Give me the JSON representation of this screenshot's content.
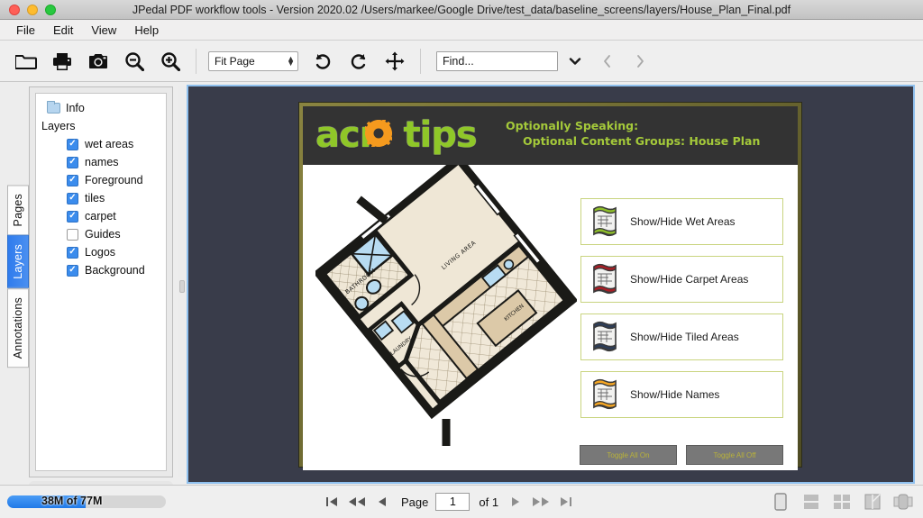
{
  "window": {
    "title": "JPedal PDF workflow tools - Version 2020.02 /Users/markee/Google Drive/test_data/baseline_screens/layers/House_Plan_Final.pdf",
    "controls": [
      "close",
      "minimize",
      "maximize"
    ]
  },
  "menubar": {
    "items": [
      {
        "label": "File"
      },
      {
        "label": "Edit"
      },
      {
        "label": "View"
      },
      {
        "label": "Help"
      }
    ]
  },
  "toolbar": {
    "buttons": [
      {
        "name": "open-file-icon",
        "title": "Open"
      },
      {
        "name": "print-icon",
        "title": "Print"
      },
      {
        "name": "snapshot-icon",
        "title": "Snapshot"
      },
      {
        "name": "zoom-out-icon",
        "title": "Zoom Out"
      },
      {
        "name": "zoom-in-icon",
        "title": "Zoom In"
      }
    ],
    "zoom_value": "Fit Page",
    "rotate_left": "Rotate Left",
    "rotate_right": "Rotate Right",
    "pan": "Pan",
    "find_placeholder": "Find...",
    "find_value": "",
    "find_dropdown": "⌄",
    "find_prev": "‹",
    "find_next": "›"
  },
  "sidebar": {
    "tabs": [
      {
        "label": "Pages",
        "active": false
      },
      {
        "label": "Layers",
        "active": true
      },
      {
        "label": "Annotations",
        "active": false
      }
    ],
    "tree": {
      "info_label": "Info",
      "group_label": "Layers",
      "layers": [
        {
          "label": "wet areas",
          "checked": true
        },
        {
          "label": "names",
          "checked": true
        },
        {
          "label": "Foreground",
          "checked": true
        },
        {
          "label": "tiles",
          "checked": true
        },
        {
          "label": "carpet",
          "checked": true
        },
        {
          "label": "Guides",
          "checked": false
        },
        {
          "label": "Logos",
          "checked": true
        },
        {
          "label": "Background",
          "checked": true
        }
      ]
    }
  },
  "document": {
    "logo_text_1": "acr",
    "logo_text_2": "tips",
    "headline_line1": "Optionally Speaking:",
    "headline_line2": "Optional Content Groups:  House Plan",
    "floorplan": {
      "labels": [
        {
          "text": "BATHROOM"
        },
        {
          "text": "LIVING AREA"
        },
        {
          "text": "LAUNDRY"
        },
        {
          "text": "KITCHEN"
        }
      ]
    },
    "option_buttons": [
      {
        "label": "Show/Hide Wet Areas",
        "band_color": "#8fbf2a"
      },
      {
        "label": "Show/Hide Carpet Areas",
        "band_color": "#a81f26"
      },
      {
        "label": "Show/Hide Tiled Areas",
        "band_color": "#2d3d57"
      },
      {
        "label": "Show/Hide Names",
        "band_color": "#f5a623"
      }
    ],
    "toggle_buttons": [
      {
        "label": "Toggle All On"
      },
      {
        "label": "Toggle All Off"
      }
    ],
    "colors": {
      "header_bg": "#333333",
      "logo_green": "#8fc728",
      "gear_orange": "#f59a1e",
      "headline_green": "#a4c93a",
      "page_border": "#6a6630",
      "viewer_bg": "#393c4a"
    }
  },
  "statusbar": {
    "memory_text": "38M of 77M",
    "memory_used": 38,
    "memory_total": 77,
    "page_label": "Page",
    "page_value": "1",
    "page_of": "of 1",
    "nav": [
      {
        "name": "first-page-button",
        "glyph": "|◀"
      },
      {
        "name": "fast-rewind-button",
        "glyph": "◀◀"
      },
      {
        "name": "previous-page-button",
        "glyph": "◀"
      },
      {
        "name": "next-page-button",
        "glyph": "▶"
      },
      {
        "name": "fast-forward-button",
        "glyph": "▶▶"
      },
      {
        "name": "last-page-button",
        "glyph": "▶|"
      }
    ],
    "view_modes": [
      {
        "name": "single-page-view-icon"
      },
      {
        "name": "continuous-view-icon"
      },
      {
        "name": "facing-pages-view-icon"
      },
      {
        "name": "book-view-icon"
      },
      {
        "name": "page-flow-view-icon"
      }
    ]
  }
}
